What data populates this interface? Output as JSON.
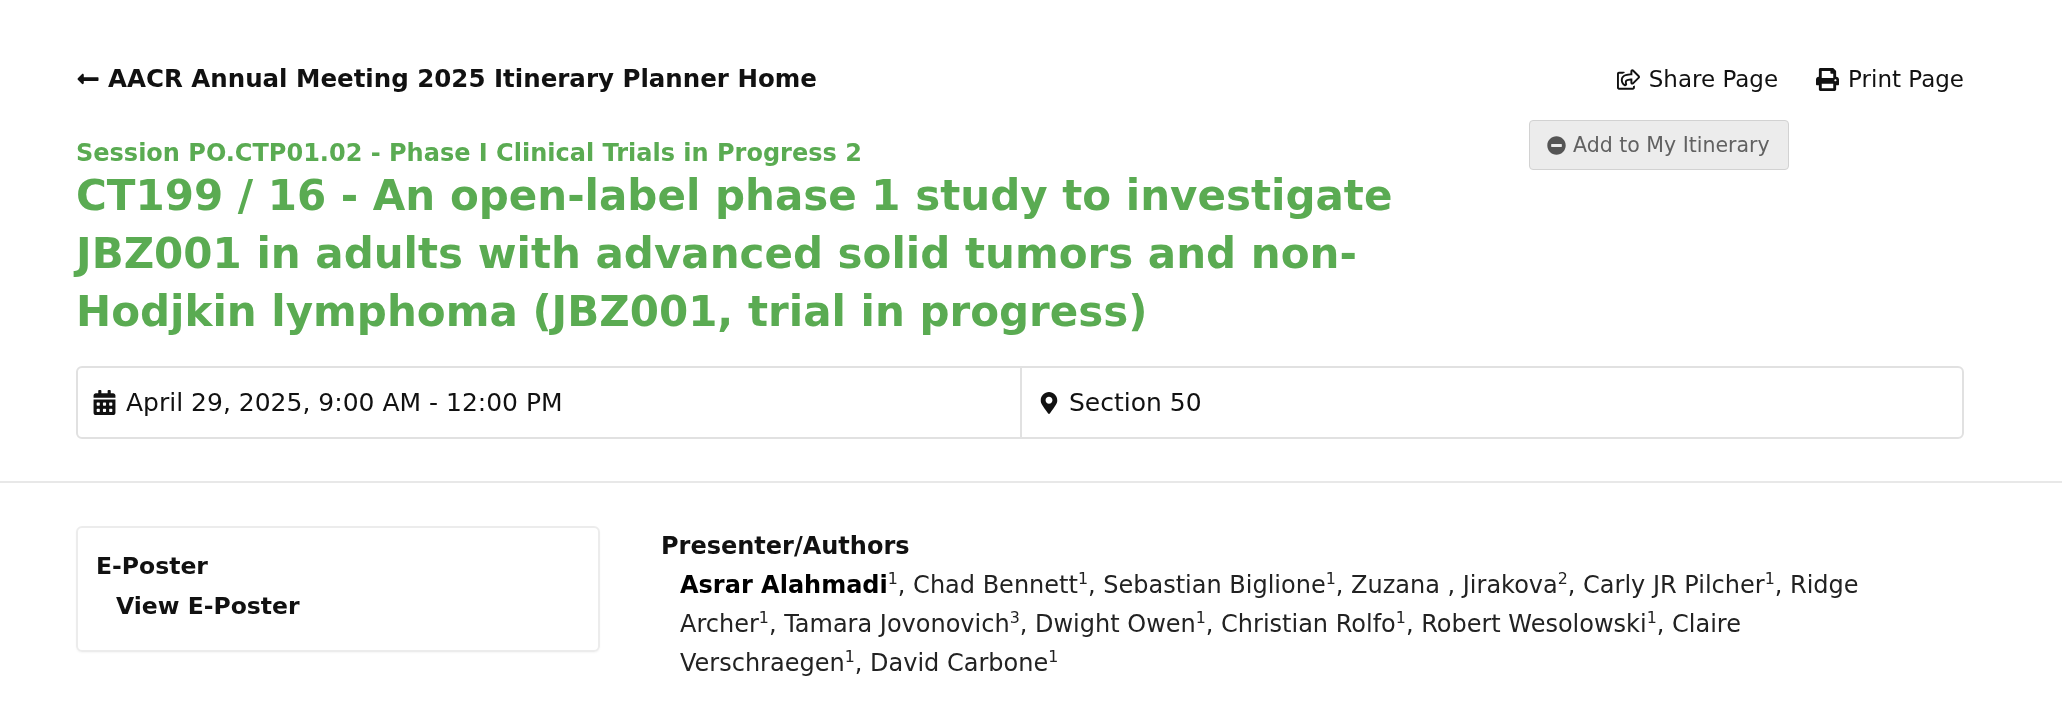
{
  "back_link": {
    "label": "AACR Annual Meeting 2025 Itinerary Planner Home"
  },
  "page_actions": [
    {
      "kind": "share",
      "label": "Share Page"
    },
    {
      "kind": "print",
      "label": "Print Page"
    }
  ],
  "itinerary_button": {
    "label": "Add to My Itinerary"
  },
  "session": "Session PO.CTP01.02 - Phase I Clinical Trials in Progress 2",
  "title": "CT199 / 16 - An open-label phase 1 study to investigate JBZ001 in adults with advanced solid tumors and non-Hodjkin lymphoma (JBZ001, trial in progress)",
  "details": [
    {
      "kind": "date",
      "text": "April 29, 2025, 9:00 AM - 12:00 PM"
    },
    {
      "kind": "location",
      "text": "Section 50"
    }
  ],
  "eposter": {
    "heading": "E-Poster",
    "link": "View E-Poster"
  },
  "authors": {
    "heading": "Presenter/Authors",
    "text": "**Asrar Alahmadi**$^{1}$, Chad Bennett$^{1}$, Sebastian Biglione$^{1}$, Zuzana , Jirakova$^{2}$, Carly JR Pilcher$^{1}$, Ridge Archer$^{1}$, Tamara Jovonovich$^{3}$, Dwight Owen$^{1}$, Christian Rolfo$^{1}$, Robert Wesolowski$^{1}$, Claire Verschraegen$^{1}$, David Carbone$^{1}$"
  }
}
